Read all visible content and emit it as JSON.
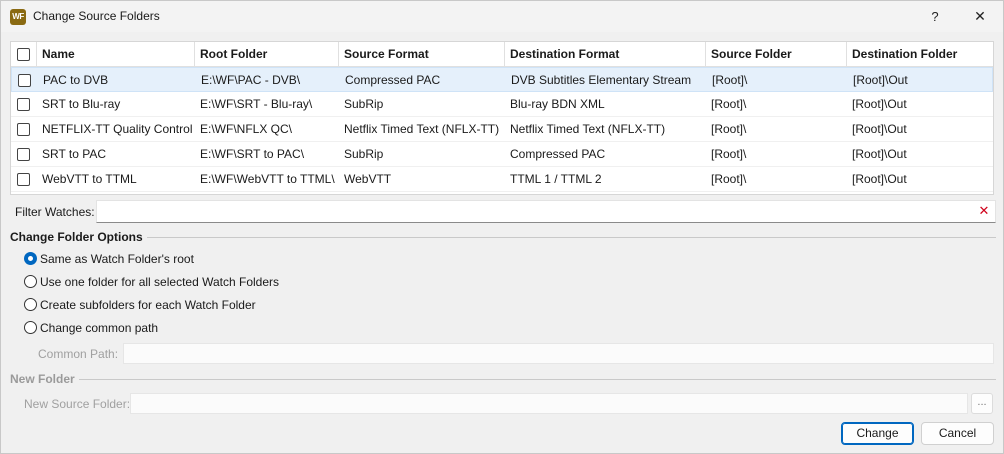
{
  "window": {
    "icon_text": "WF",
    "title": "Change Source Folders",
    "help_label": "?",
    "close_label": "✕"
  },
  "table": {
    "columns": [
      "Name",
      "Root Folder",
      "Source Format",
      "Destination Format",
      "Source Folder",
      "Destination Folder"
    ],
    "rows": [
      {
        "name": "PAC to DVB",
        "root": "E:\\WF\\PAC - DVB\\",
        "source_format": "Compressed PAC",
        "dest_format": "DVB Subtitles Elementary Stream",
        "source_folder": "[Root]\\",
        "dest_folder": "[Root]\\Out"
      },
      {
        "name": "SRT to Blu-ray",
        "root": "E:\\WF\\SRT - Blu-ray\\",
        "source_format": "SubRip",
        "dest_format": "Blu-ray BDN XML",
        "source_folder": "[Root]\\",
        "dest_folder": "[Root]\\Out"
      },
      {
        "name": "NETFLIX-TT Quality Control",
        "root": "E:\\WF\\NFLX QC\\",
        "source_format": "Netflix Timed Text (NFLX-TT)",
        "dest_format": "Netflix Timed Text (NFLX-TT)",
        "source_folder": "[Root]\\",
        "dest_folder": "[Root]\\Out"
      },
      {
        "name": "SRT to PAC",
        "root": "E:\\WF\\SRT to PAC\\",
        "source_format": "SubRip",
        "dest_format": "Compressed PAC",
        "source_folder": "[Root]\\",
        "dest_folder": "[Root]\\Out"
      },
      {
        "name": "WebVTT to TTML",
        "root": "E:\\WF\\WebVTT to TTML\\",
        "source_format": "WebVTT",
        "dest_format": "TTML 1 / TTML 2",
        "source_folder": "[Root]\\",
        "dest_folder": "[Root]\\Out"
      }
    ]
  },
  "filter": {
    "label": "Filter Watches:",
    "value": "",
    "clear_label": "✕"
  },
  "change_options": {
    "title": "Change Folder Options",
    "options": [
      {
        "label": "Same as Watch Folder's root",
        "checked": true
      },
      {
        "label": "Use one folder for all selected Watch Folders",
        "checked": false
      },
      {
        "label": "Create subfolders for each Watch Folder",
        "checked": false
      },
      {
        "label": "Change common path",
        "checked": false
      }
    ],
    "common_path_label": "Common Path:",
    "common_path_value": ""
  },
  "new_folder": {
    "title": "New Folder",
    "source_label": "New Source Folder:",
    "source_value": "",
    "browse_label": "..."
  },
  "buttons": {
    "change": "Change",
    "cancel": "Cancel"
  },
  "colors": {
    "accent": "#0067c0",
    "selection": "#e5f0fb",
    "clear": "#d0021b"
  }
}
